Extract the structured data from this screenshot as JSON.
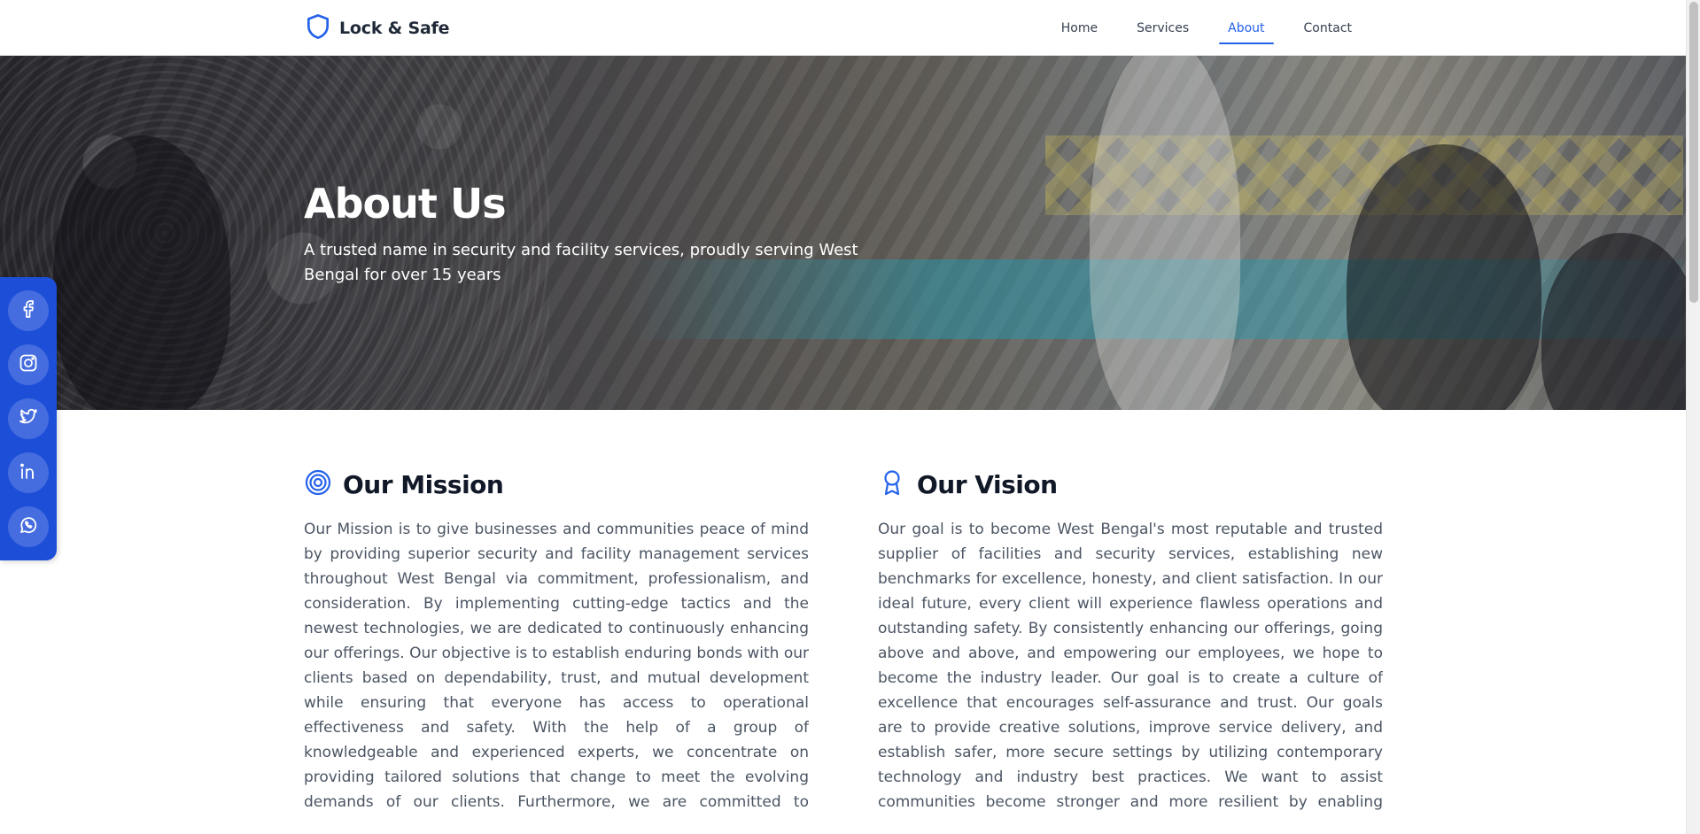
{
  "brand": {
    "name": "Lock & Safe",
    "icon": "shield-icon"
  },
  "nav": {
    "items": [
      {
        "label": "Home",
        "active": false
      },
      {
        "label": "Services",
        "active": false
      },
      {
        "label": "About",
        "active": true
      },
      {
        "label": "Contact",
        "active": false
      }
    ]
  },
  "hero": {
    "title": "About Us",
    "subtitle": "A trusted name in security and facility services, proudly serving West Bengal for over 15 years"
  },
  "social": {
    "items": [
      {
        "icon": "facebook-icon"
      },
      {
        "icon": "instagram-icon"
      },
      {
        "icon": "twitter-icon"
      },
      {
        "icon": "linkedin-icon"
      },
      {
        "icon": "whatsapp-icon"
      }
    ]
  },
  "mission": {
    "icon": "target-icon",
    "title": "Our Mission",
    "body": "Our Mission is to give businesses and communities peace of mind by providing superior security and facility management services throughout West Bengal via commitment, professionalism, and consideration. By implementing cutting-edge tactics and the newest technologies, we are dedicated to continuously enhancing our offerings. Our objective is to establish enduring bonds with our clients based on dependability, trust, and mutual development while ensuring that everyone has access to operational effectiveness and safety. With the help of a group of knowledgeable and experienced experts, we concentrate on providing tailored solutions that change to meet the evolving demands of our clients. Furthermore, we are committed to cultivating a culture of ongoing expansion and sustainability, staying ahead of market trends while maintaining the highest moral standards."
  },
  "vision": {
    "icon": "award-icon",
    "title": "Our Vision",
    "body": "Our goal is to become West Bengal's most reputable and trusted supplier of facilities and security services, establishing new benchmarks for excellence, honesty, and client satisfaction. In our ideal future, every client will experience flawless operations and outstanding safety. By consistently enhancing our offerings, going above and above, and empowering our employees, we hope to become the industry leader. Our goal is to create a culture of excellence that encourages self-assurance and trust. Our goals are to provide creative solutions, improve service delivery, and establish safer, more secure settings by utilizing contemporary technology and industry best practices. We want to assist communities become stronger and more resilient by enabling everyone to have access to security and operational excellence through expansion and cooperation."
  },
  "colors": {
    "accent": "#2563eb",
    "social_rail": "#1d4ed8"
  }
}
